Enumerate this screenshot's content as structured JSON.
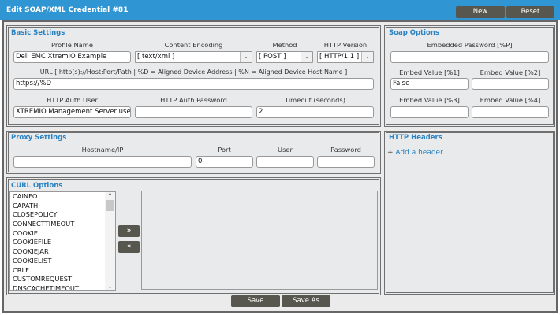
{
  "title": "Edit SOAP/XML Credential #81",
  "header_buttons": {
    "new": "New",
    "reset": "Reset"
  },
  "basic": {
    "legend": "Basic Settings",
    "profile_name_label": "Profile Name",
    "profile_name": "Dell EMC XtremIO Example",
    "content_encoding_label": "Content Encoding",
    "content_encoding": "[ text/xml ]",
    "method_label": "Method",
    "method": "[ POST ]",
    "http_version_label": "HTTP Version",
    "http_version": "[ HTTP/1.1 ]",
    "url_label": "URL [ http(s)://Host:Port/Path | %D = Aligned Device Address | %N = Aligned Device Host Name ]",
    "url": "https://%D",
    "auth_user_label": "HTTP Auth User",
    "auth_user": "XTREMIO Management Server user name",
    "auth_password_label": "HTTP Auth Password",
    "auth_password": "",
    "timeout_label": "Timeout (seconds)",
    "timeout": "2"
  },
  "soap": {
    "legend": "Soap Options",
    "embedded_password_label": "Embedded Password [%P]",
    "embedded_password": "",
    "embed1_label": "Embed Value [%1]",
    "embed1": "False",
    "embed2_label": "Embed Value [%2]",
    "embed2": "",
    "embed3_label": "Embed Value [%3]",
    "embed3": "",
    "embed4_label": "Embed Value [%4]",
    "embed4": ""
  },
  "proxy": {
    "legend": "Proxy Settings",
    "host_label": "Hostname/IP",
    "host": "",
    "port_label": "Port",
    "port": "0",
    "user_label": "User",
    "user": "",
    "password_label": "Password",
    "password": ""
  },
  "headers": {
    "legend": "HTTP Headers",
    "add": "Add a header"
  },
  "curl": {
    "legend": "CURL Options",
    "options": [
      "CAINFO",
      "CAPATH",
      "CLOSEPOLICY",
      "CONNECTTIMEOUT",
      "COOKIE",
      "COOKIEFILE",
      "COOKIEJAR",
      "COOKIELIST",
      "CRLF",
      "CUSTOMREQUEST",
      "DNSCACHETIMEOUT"
    ],
    "add": "»",
    "remove": "«"
  },
  "footer": {
    "save": "Save",
    "save_as": "Save As"
  }
}
